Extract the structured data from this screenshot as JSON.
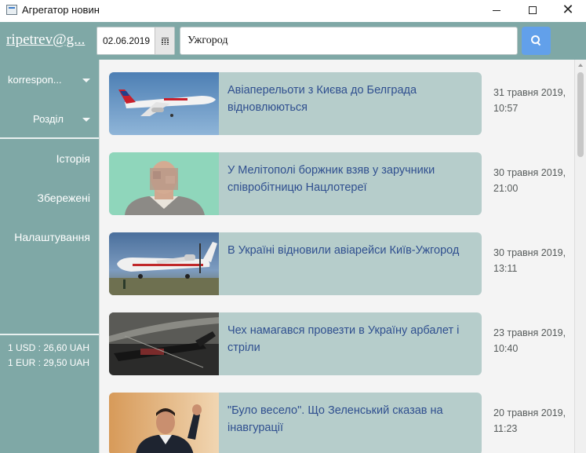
{
  "window": {
    "title": "Агрегатор новин",
    "icon": "app-window-icon",
    "controls": [
      "minimize-icon",
      "maximize-icon",
      "close-icon"
    ]
  },
  "header": {
    "user": "ripetrev@g...",
    "date_value": "02.06.2019",
    "search_value": "Ужгород",
    "calendar_icon": "calendar-icon",
    "search_icon": "search-icon",
    "search_button_color": "#62a0ea"
  },
  "sidebar": {
    "source_dropdown": "korrespon...",
    "section_dropdown": "Розділ",
    "items": [
      {
        "label": "Історія"
      },
      {
        "label": "Збережені"
      },
      {
        "label": "Налаштування"
      }
    ],
    "currency": [
      {
        "label": "1 USD : 26,60 UAH"
      },
      {
        "label": "1 EUR : 29,50 UAH"
      }
    ],
    "background_color": "#7fa8a6"
  },
  "news": [
    {
      "headline": "Авіаперельоти з Києва до Белграда відновлюються",
      "date": "31 травня 2019,",
      "time": "10:57",
      "image": "airplane-photo"
    },
    {
      "headline": "У Мелітополі боржник взяв у заручники співробітницю Нацлотереї",
      "date": "30 травня 2019,",
      "time": "21:00",
      "image": "person-photo"
    },
    {
      "headline": "В Україні відновили авіарейси Київ-Ужгород",
      "date": "30 травня 2019,",
      "time": "13:11",
      "image": "turboprop-photo"
    },
    {
      "headline": "Чех намагався провезти в Україну арбалет і стріли",
      "date": "23 травня 2019,",
      "time": "10:40",
      "image": "crossbow-photo"
    },
    {
      "headline": "\"Було весело\". Що Зеленський сказав на інавгурації",
      "date": "20 травня 2019,",
      "time": "11:23",
      "image": "politician-photo"
    }
  ],
  "card_color": "#b6cdcb",
  "headline_color": "#2f4f8f"
}
